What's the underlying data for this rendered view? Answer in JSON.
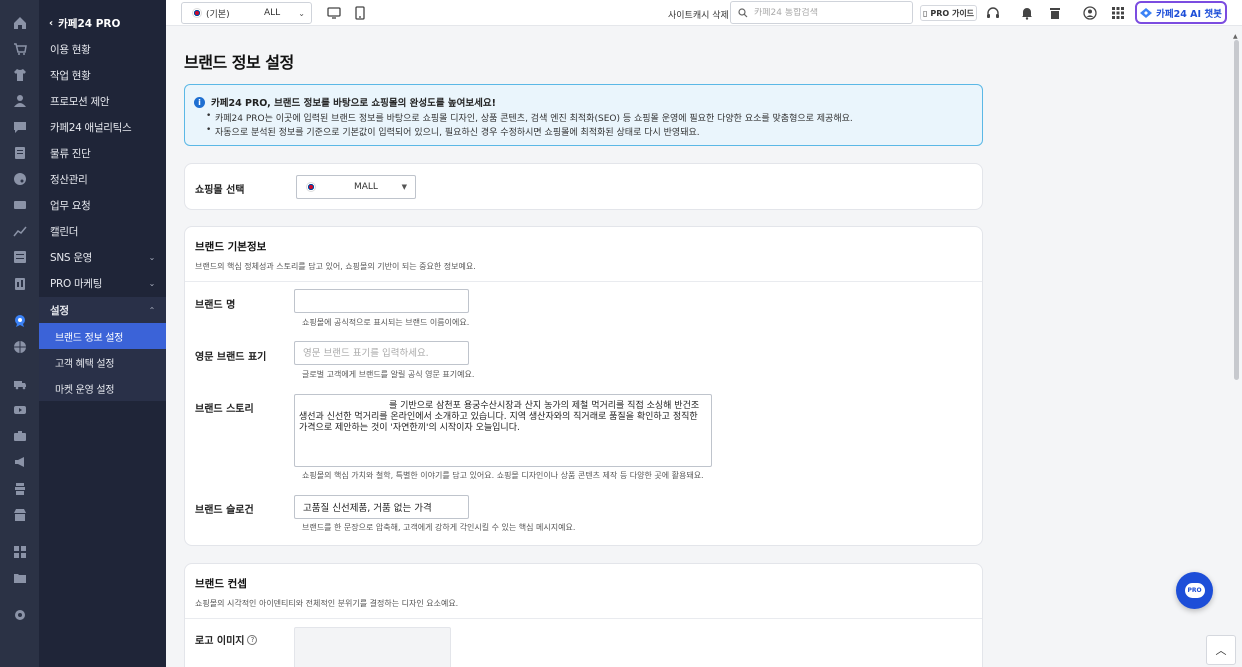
{
  "sidebar": {
    "back_label": "카페24 PRO",
    "items": [
      {
        "label": "이용 현황"
      },
      {
        "label": "작업 현황"
      },
      {
        "label": "프로모션 제안"
      },
      {
        "label": "카페24 애널리틱스"
      },
      {
        "label": "물류 진단"
      },
      {
        "label": "정산관리"
      },
      {
        "label": "업무 요청"
      },
      {
        "label": "캘린더"
      },
      {
        "label": "SNS 운영"
      },
      {
        "label": "PRO 마케팅"
      },
      {
        "label": "설정"
      }
    ],
    "settings_sub": [
      {
        "label": "브랜드 정보 설정"
      },
      {
        "label": "고객 혜택 설정"
      },
      {
        "label": "마켓 운영 설정"
      }
    ]
  },
  "topbar": {
    "mall_flag_label": "(기본)",
    "mall_value": "ALL",
    "cache_delete": "사이트캐시 삭제",
    "search_placeholder": "카페24 통합검색",
    "pro_guide": "PRO 가이드",
    "ai_chatbot": "카페24 AI 챗봇"
  },
  "page": {
    "title": "브랜드 정보 설정"
  },
  "notice": {
    "heading": "카페24 PRO, 브랜드 정보를 바탕으로 쇼핑몰의 완성도를 높여보세요!",
    "lines": [
      "카페24 PRO는 이곳에 입력된 브랜드 정보를 바탕으로 쇼핑몰 디자인, 상품 콘텐츠, 검색 엔진 최적화(SEO) 등 쇼핑몰 운영에 필요한 다양한 요소를 맞춤형으로 제공해요.",
      "자동으로 분석된 정보를 기준으로 기본값이 입력되어 있으니, 필요하신 경우 수정하시면 쇼핑몰에 최적화된 상태로 다시 반영돼요."
    ]
  },
  "mall_select": {
    "label": "쇼핑몰 선택",
    "value": "MALL"
  },
  "brand_basic": {
    "title": "브랜드 기본정보",
    "desc": "브랜드의 핵심 정체성과 스토리를 담고 있어, 쇼핑몰의 기반이 되는 중요한 정보예요.",
    "name": {
      "label": "브랜드 명",
      "value": "",
      "help": "쇼핑몰에 공식적으로 표시되는 브랜드 이름이에요."
    },
    "eng_name": {
      "label": "영문 브랜드 표기",
      "placeholder": "영문 브랜드 표기를 입력하세요.",
      "help": "글로벌 고객에게 브랜드를 알릴 공식 영문 표기예요."
    },
    "story": {
      "label": "브랜드 스토리",
      "value": "　　　　　　　　　　를 기반으로 삼천포 용궁수산시장과 산지 농가의 제철 먹거리를 직접 소싱해 반건조 생선과 신선한 먹거리를 온라인에서 소개하고 있습니다. 지역 생산자와의 직거래로 품질을 확인하고 정직한 가격으로 제안하는 것이 '자연한끼'의 시작이자 오늘입니다.",
      "help": "쇼핑몰의 핵심 가치와 철학, 특별한 이야기를 담고 있어요. 쇼핑몰 디자인이나 상품 콘텐츠 제작 등 다양한 곳에 활용돼요."
    },
    "slogan": {
      "label": "브랜드 슬로건",
      "value": "고품질 신선제품, 거품 없는 가격",
      "help": "브랜드를 한 문장으로 압축해, 고객에게 강하게 각인시킬 수 있는 핵심 메시지예요."
    }
  },
  "brand_concept": {
    "title": "브랜드 컨셉",
    "desc": "쇼핑몰의 시각적인 아이덴티티와 전체적인 분위기를 결정하는 디자인 요소예요.",
    "logo_label": "로고 이미지"
  },
  "fab": {
    "pro_label": "PRO",
    "top_label": "^"
  }
}
